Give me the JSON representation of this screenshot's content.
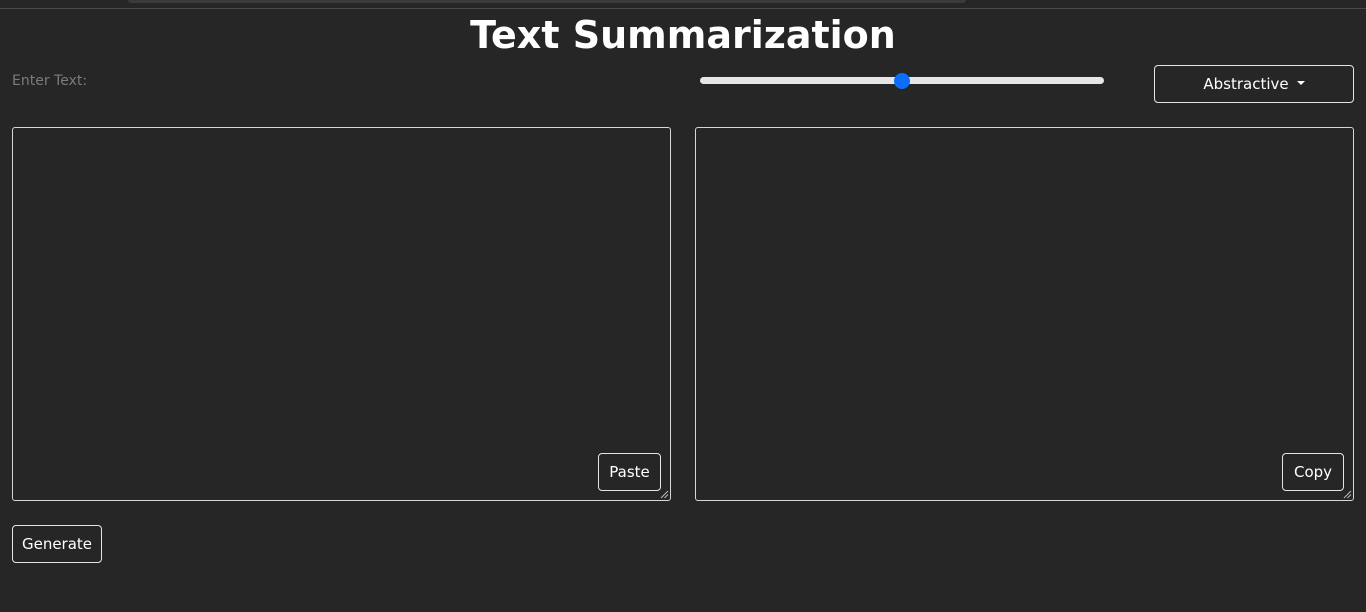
{
  "page": {
    "title": "Text Summarization"
  },
  "input": {
    "label": "Enter Text:",
    "value": "",
    "paste_label": "Paste"
  },
  "output": {
    "value": "",
    "copy_label": "Copy"
  },
  "controls": {
    "length_slider_fraction": 0.5,
    "accent_color": "#0d6efd",
    "mode_selected": "Abstractive"
  },
  "actions": {
    "generate_label": "Generate"
  },
  "colors": {
    "background": "#262626",
    "border": "#e5e5e5",
    "muted_text": "#7b7b7b"
  }
}
